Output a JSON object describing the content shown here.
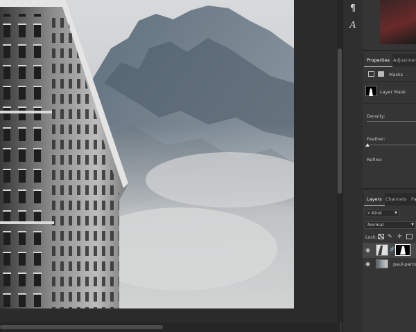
{
  "tool_strip": {
    "paragraph_glyph": "¶",
    "glyph_panel_glyph": "A"
  },
  "properties_panel": {
    "tabs": [
      {
        "label": "Properties",
        "active": true
      },
      {
        "label": "Adjustments",
        "active": false
      }
    ],
    "masks_label": "Masks",
    "layer_mask_label": "Layer Mask",
    "density_label": "Density:",
    "feather_label": "Feather:",
    "refine_label": "Refine:"
  },
  "layers_panel": {
    "tabs": [
      {
        "label": "Layers",
        "active": true
      },
      {
        "label": "Channels",
        "active": false
      },
      {
        "label": "Pa",
        "active": false
      }
    ],
    "filter_kind": "Kind",
    "blend_mode": "Normal",
    "lock_label": "Lock:",
    "layers": [
      {
        "name": "",
        "visible": true,
        "has_mask": true
      },
      {
        "name": "paul-partou",
        "visible": true,
        "has_mask": false
      }
    ]
  },
  "colors": {
    "panel_bg": "#353535",
    "workspace_bg": "#2b2b2b",
    "accent_fg": "#ffffff"
  }
}
